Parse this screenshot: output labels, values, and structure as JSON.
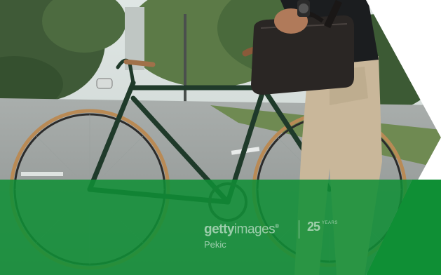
{
  "watermark": {
    "brand_bold": "getty",
    "brand_light": "images",
    "registered": "®",
    "credit": "Pekic",
    "anniversary_number": "25",
    "anniversary_label": "YEARS"
  },
  "colors": {
    "overlay_green": "#0f8f35",
    "chevron_white": "#ffffff",
    "bike_frame": "#1f3a2a",
    "tire": "#b98a55",
    "trousers": "#c9b79a",
    "bag": "#2a2624"
  },
  "elements": {
    "photo": "man-with-bicycle-photo",
    "overlay": "green-band-overlay",
    "shape": "white-chevron-arrow"
  }
}
